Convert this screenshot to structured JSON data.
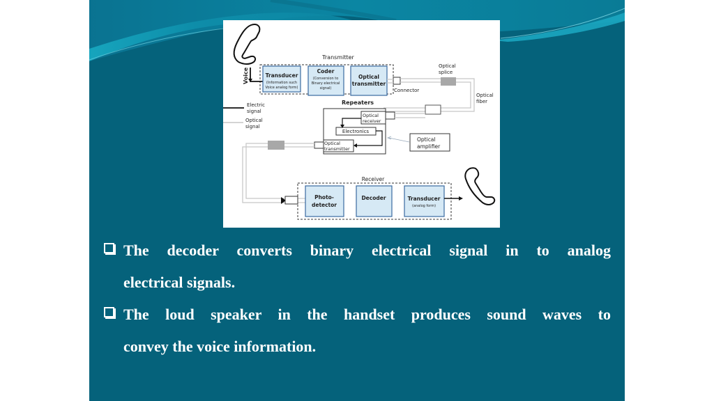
{
  "slide": {
    "colors": {
      "background": "#05627b",
      "wave_light": "#1aa3bd",
      "wave_mid": "#0b7d98",
      "text": "#ffffff",
      "block_fill": "#d6e9f5",
      "block_border": "#3a6aa0",
      "optical_line": "#c8c8c8",
      "splice_fill": "#a8a8a8"
    },
    "diagram": {
      "transmitter_title": "Transmitter",
      "voice_label": "Voice",
      "transmitter_blocks": [
        {
          "title": "Transducer",
          "subtitle": [
            "(Information such",
            "Voice analog form)"
          ]
        },
        {
          "title": "Coder",
          "subtitle": [
            "(Conversion to",
            "Binary electrical",
            "signal)"
          ]
        },
        {
          "title": "Optical",
          "title2": "transmitter",
          "subtitle": []
        }
      ],
      "connector_label": "Connector",
      "optical_splice_label": [
        "Optical",
        "splice"
      ],
      "optical_fiber_label": [
        "Optical",
        "fiber"
      ],
      "legend": {
        "electric": [
          "Electric",
          "signal"
        ],
        "optical": [
          "Optical",
          "signal"
        ]
      },
      "repeaters_title": "Repeaters",
      "repeater_blocks": {
        "optical_receiver": [
          "Optical",
          "receiver"
        ],
        "electronics": "Electronics",
        "optical_transmitter": [
          "Optical",
          "transmitter"
        ]
      },
      "optical_amplifier_label": [
        "Optical",
        "amplifier"
      ],
      "receiver_title": "Receiver",
      "receiver_blocks": [
        {
          "title": "Photo-",
          "title2": "detector",
          "subtitle": ""
        },
        {
          "title": "Decoder",
          "title2": "",
          "subtitle": ""
        },
        {
          "title": "Transducer",
          "title2": "",
          "subtitle": "(analog form)"
        }
      ]
    },
    "bullets": [
      {
        "line1": "The decoder converts binary electrical signal in to analog",
        "line2": "electrical signals."
      },
      {
        "line1": "The loud speaker in the handset produces sound waves to",
        "line2": "convey the voice information."
      }
    ]
  }
}
